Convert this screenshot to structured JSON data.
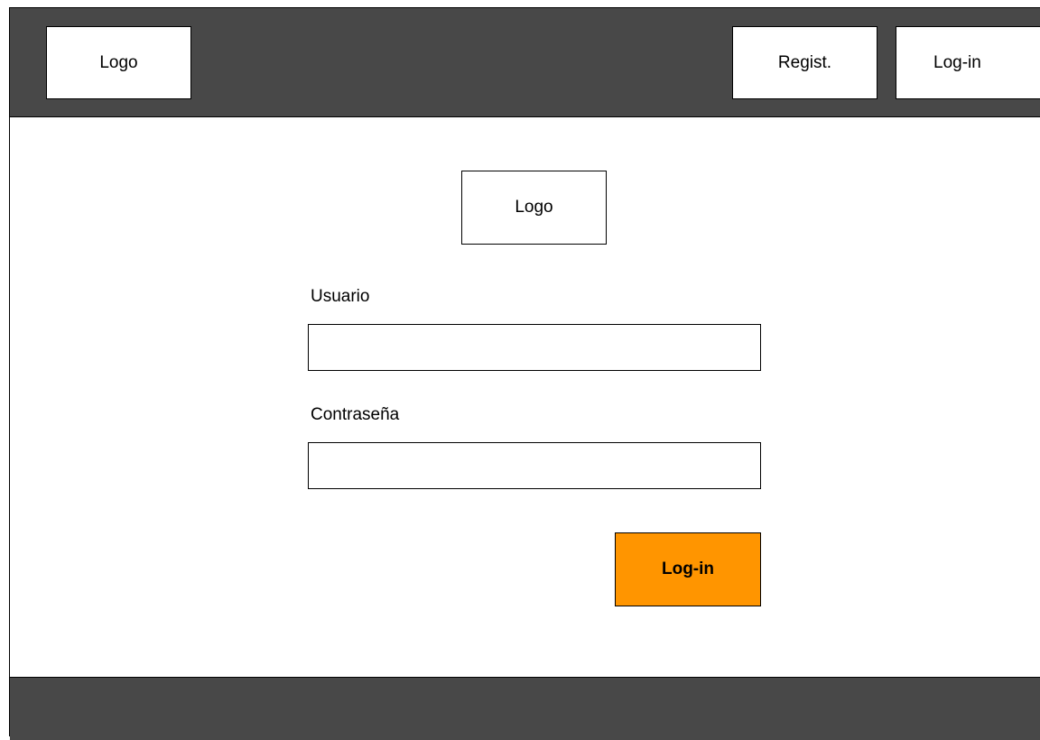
{
  "header": {
    "logo_label": "Logo",
    "register_label": "Regist.",
    "login_label": "Log-in"
  },
  "form": {
    "logo_label": "Logo",
    "username_label": "Usuario",
    "username_value": "",
    "password_label": "Contraseña",
    "password_value": "",
    "submit_label": "Log-in"
  },
  "colors": {
    "bar_background": "#484848",
    "submit_accent": "#ff9500",
    "page_background": "#ffffff"
  }
}
